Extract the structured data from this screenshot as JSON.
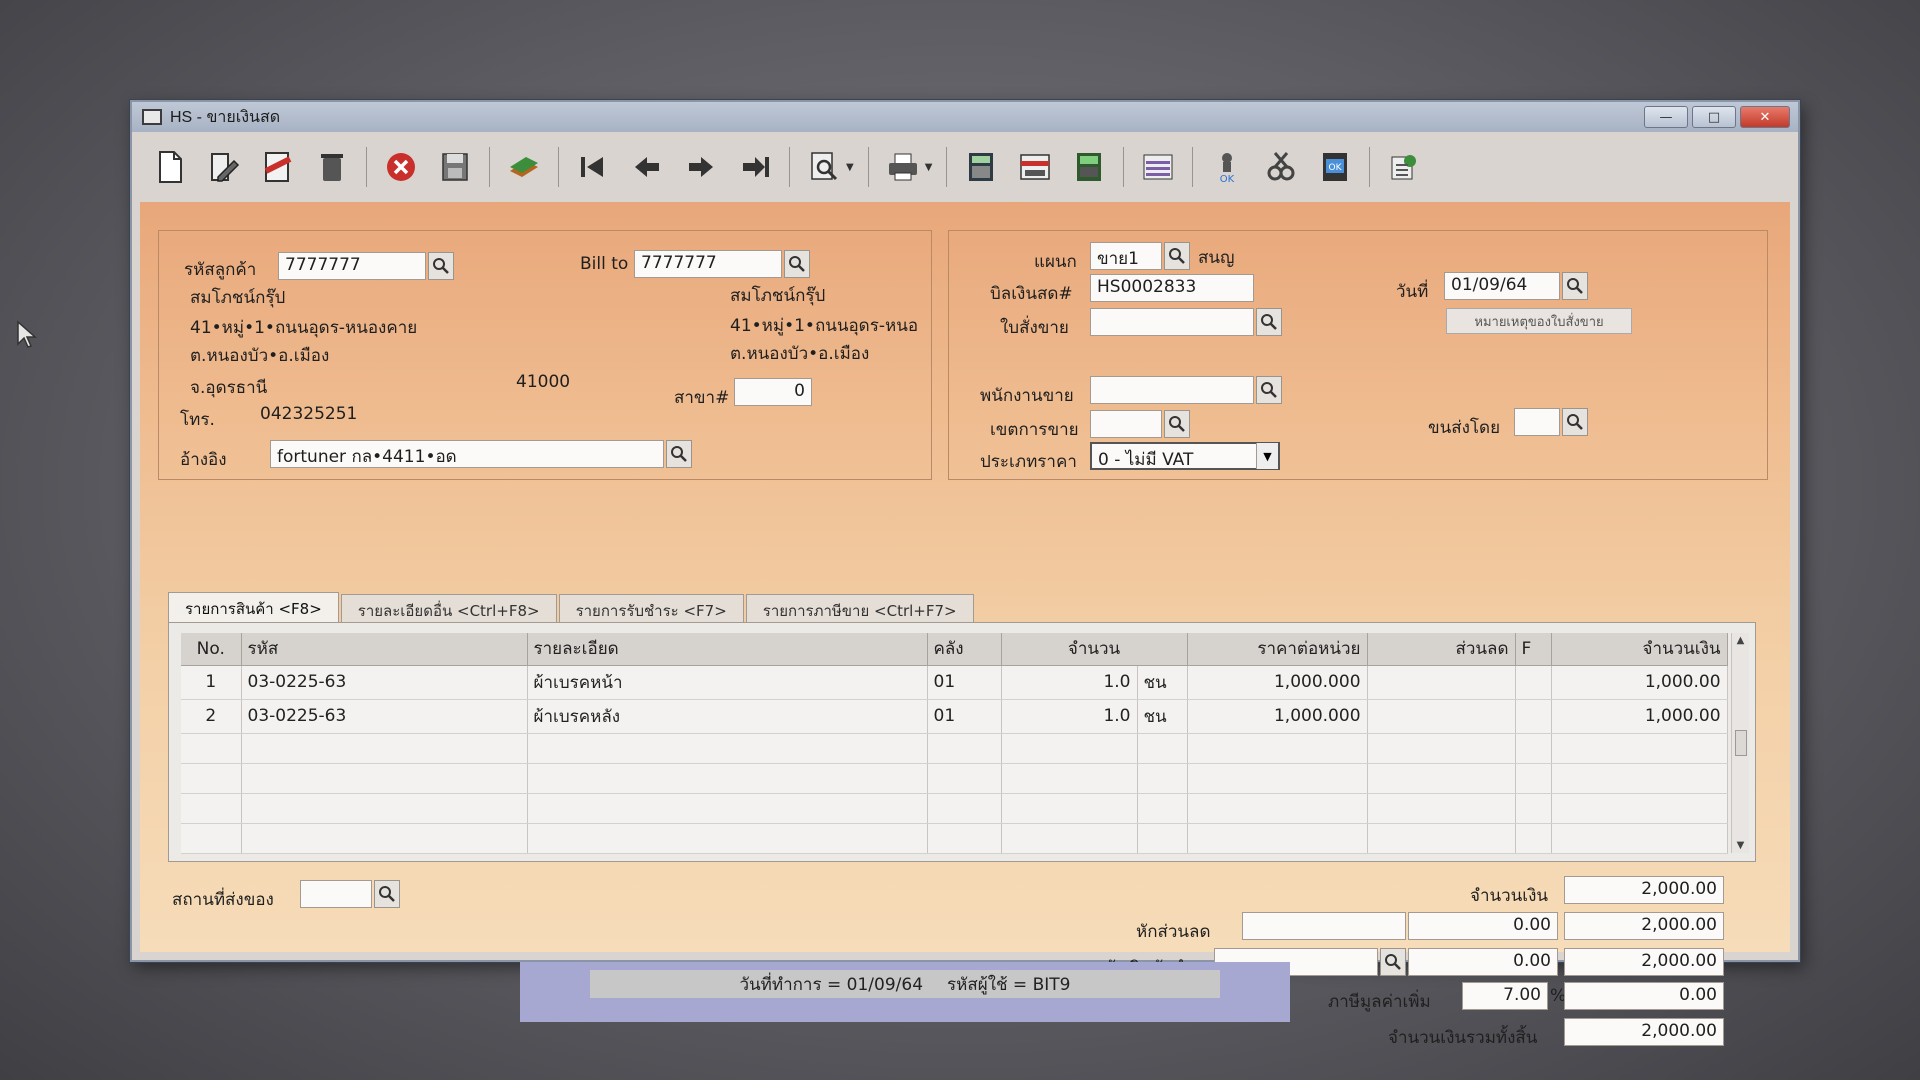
{
  "window": {
    "title": "HS - ขายเงินสด"
  },
  "toolbar": {
    "icons": [
      "new-doc-icon",
      "edit-icon",
      "void-icon",
      "delete-icon",
      "cancel-icon",
      "save-icon",
      "batch-icon",
      "first-icon",
      "prev-icon",
      "next-icon",
      "last-icon",
      "find-icon",
      "print-icon",
      "calc-icon",
      "card-icon",
      "vo-icon",
      "report-icon",
      "approve-icon",
      "tool-icon",
      "ok-icon",
      "export-icon"
    ]
  },
  "customer": {
    "code_label": "รหัสลูกค้า",
    "code": "7777777",
    "name": "สมโภชน์กรุ๊ป",
    "addr1": "41•หมู่•1•ถนนอุดร-หนองคาย",
    "addr2": "ต.หนองบัว•อ.เมือง",
    "province": "จ.อุดรธานี",
    "postcode": "41000",
    "phone_label": "โทร.",
    "phone": "042325251",
    "ref_label": "อ้างอิง",
    "ref": "fortuner กล•4411•อด"
  },
  "bill_to": {
    "label": "Bill to",
    "code": "7777777",
    "name": "สมโภชน์กรุ๊ป",
    "addr1": "41•หมู่•1•ถนนอุดร-หนอ",
    "addr2": "ต.หนองบัว•อ.เมือง",
    "branch_label": "สาขา#",
    "branch": "0"
  },
  "doc": {
    "dept_label": "แผนก",
    "dept": "ขาย1",
    "dept_name": "สนญ",
    "bill_no_label": "บิลเงินสด#",
    "bill_no": "HS0002833",
    "so_label": "ใบสั่งขาย",
    "so": "",
    "date_label": "วันที่",
    "date": "01/09/64",
    "so_note_button": "หมายเหตุของใบสั่งขาย",
    "salesman_label": "พนักงานขาย",
    "salesman": "",
    "area_label": "เขตการขาย",
    "area": "",
    "ship_by_label": "ขนส่งโดย",
    "ship_by": "",
    "price_type_label": "ประเภทราคา",
    "price_type": "0 - ไม่มี VAT"
  },
  "tabs": [
    "รายการสินค้า <F8>",
    "รายละเอียดอื่น <Ctrl+F8>",
    "รายการรับชำระ <F7>",
    "รายการภาษีขาย <Ctrl+F7>"
  ],
  "grid": {
    "headers": [
      "No.",
      "รหัส",
      "รายละเอียด",
      "คลัง",
      "จำนวน",
      "ราคาต่อหน่วย",
      "ส่วนลด",
      "F",
      "จำนวนเงิน"
    ],
    "rows": [
      {
        "no": "1",
        "code": "03-0225-63",
        "desc": "ผ้าเบรคหน้า",
        "wh": "01",
        "qty": "1.0",
        "unit": "ชน",
        "price": "1,000.000",
        "disc": "",
        "f": "",
        "amount": "1,000.00"
      },
      {
        "no": "2",
        "code": "03-0225-63",
        "desc": "ผ้าเบรคหลัง",
        "wh": "01",
        "qty": "1.0",
        "unit": "ชน",
        "price": "1,000.000",
        "disc": "",
        "f": "",
        "amount": "1,000.00"
      }
    ]
  },
  "footer": {
    "ship_place_label": "สถานที่ส่งของ",
    "ship_place": "",
    "amount_label": "จำนวนเงิน",
    "amount": "2,000.00",
    "discount_label": "หักส่วนลด",
    "discount_text": "",
    "discount_value": "0.00",
    "after_discount": "2,000.00",
    "deposit_label": "หักเงินมัดจำ",
    "deposit_text": "",
    "deposit_value": "0.00",
    "after_deposit": "2,000.00",
    "vat_label": "ภาษีมูลค่าเพิ่ม",
    "vat_rate": "7.00",
    "vat_pct": "%",
    "vat_amount": "0.00",
    "total_label": "จำนวนเงินรวมทั้งสิ้น",
    "total": "2,000.00"
  },
  "status": {
    "date_text": "วันที่ทำการ  =  01/09/64",
    "user_text": "รหัสผู้ใช้  =  BIT9"
  }
}
